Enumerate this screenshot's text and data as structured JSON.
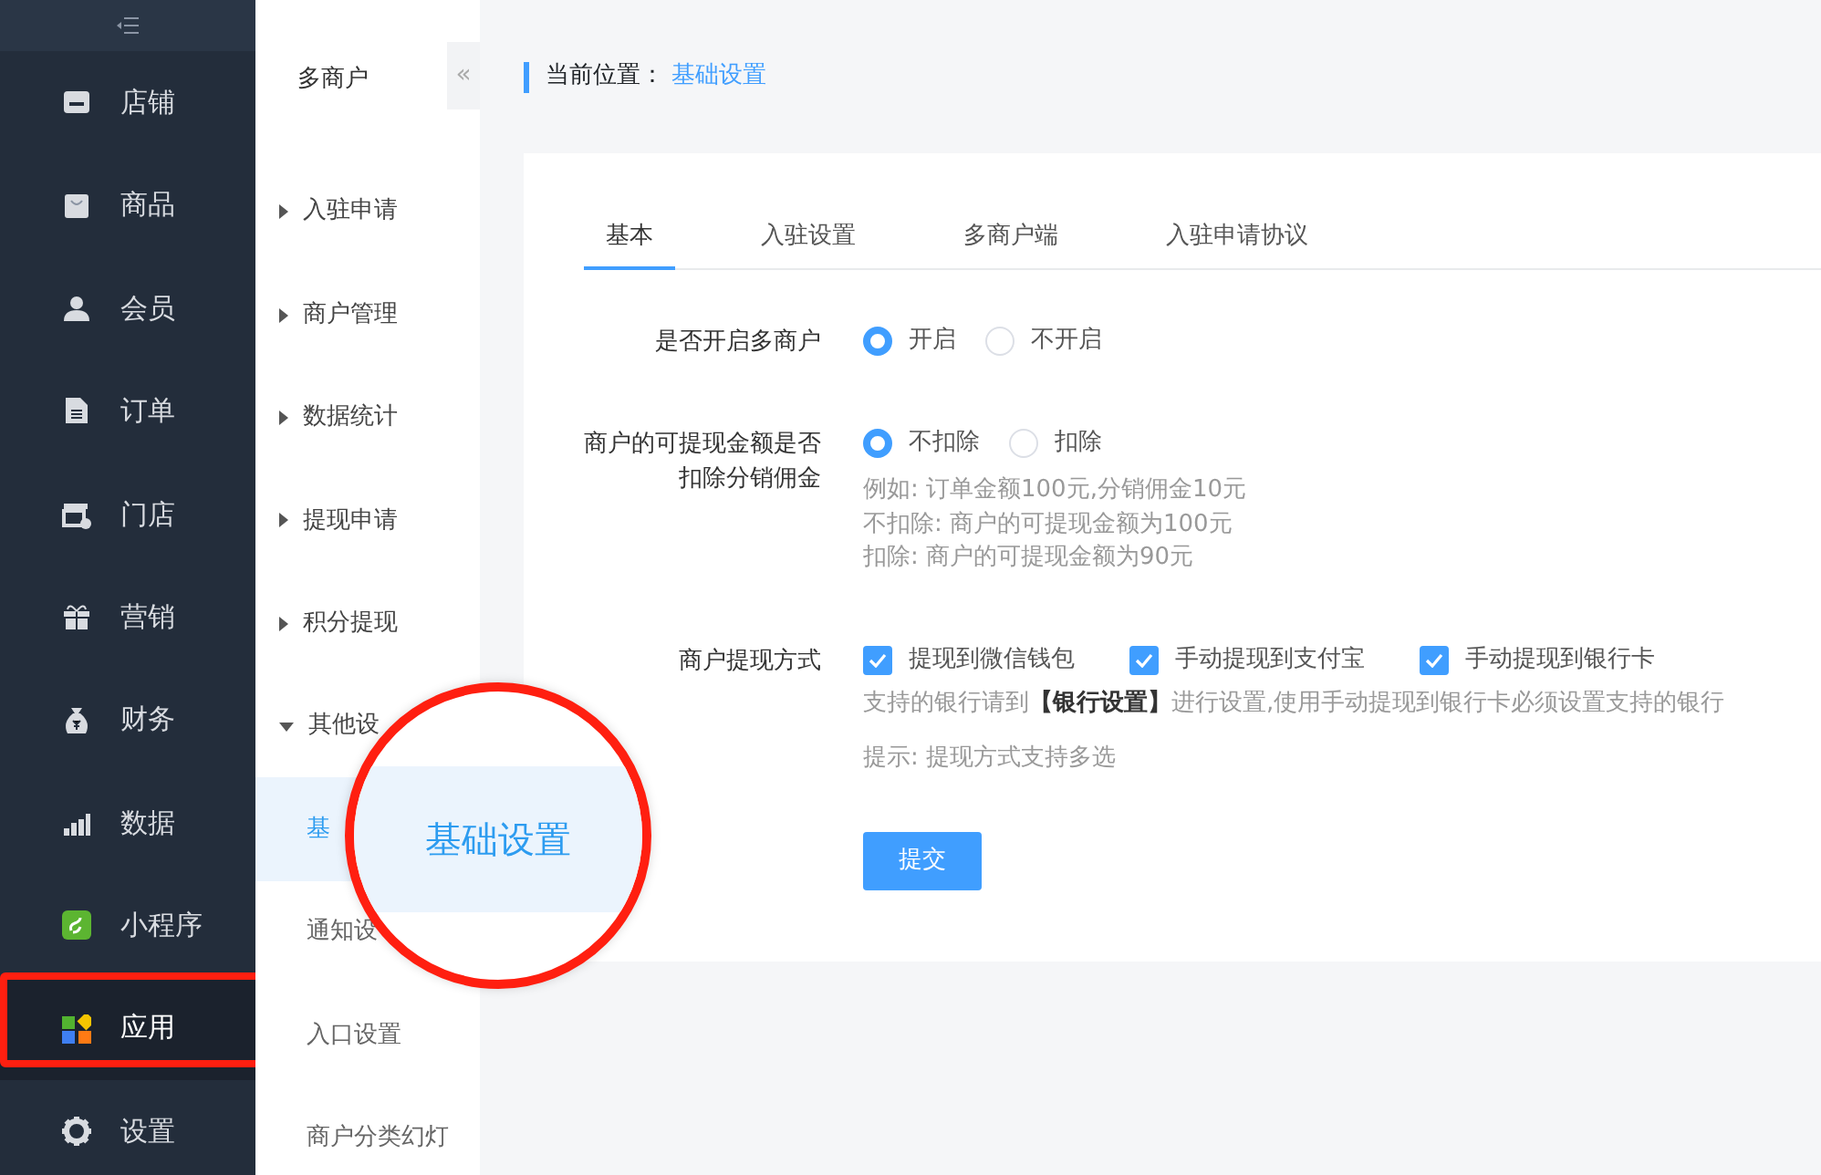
{
  "sidebar": {
    "items": [
      {
        "label": "店铺",
        "kind": "store",
        "selected": false,
        "highlighted": false
      },
      {
        "label": "商品",
        "kind": "bag",
        "selected": false,
        "highlighted": false
      },
      {
        "label": "会员",
        "kind": "user",
        "selected": false,
        "highlighted": false
      },
      {
        "label": "订单",
        "kind": "doc",
        "selected": false,
        "highlighted": false
      },
      {
        "label": "门店",
        "kind": "shop",
        "selected": false,
        "highlighted": false
      },
      {
        "label": "营销",
        "kind": "gift",
        "selected": false,
        "highlighted": false
      },
      {
        "label": "财务",
        "kind": "money",
        "selected": false,
        "highlighted": false
      },
      {
        "label": "数据",
        "kind": "chart",
        "selected": false,
        "highlighted": false
      },
      {
        "label": "小程序",
        "kind": "mini",
        "selected": false,
        "highlighted": false
      },
      {
        "label": "应用",
        "kind": "apps",
        "selected": true,
        "highlighted": true
      },
      {
        "label": "设置",
        "kind": "gear",
        "selected": false,
        "highlighted": false
      }
    ]
  },
  "subnav": {
    "title": "多商户",
    "collapse_button": "«",
    "items": [
      {
        "label": "入驻申请",
        "expanded": false
      },
      {
        "label": "商户管理",
        "expanded": false
      },
      {
        "label": "数据统计",
        "expanded": false
      },
      {
        "label": "提现申请",
        "expanded": false
      },
      {
        "label": "积分提现",
        "expanded": false
      },
      {
        "label": "其他设",
        "expanded": true,
        "children": [
          {
            "label": "基",
            "selected": true
          },
          {
            "label": "通知设",
            "selected": false
          },
          {
            "label": "入口设置",
            "selected": false
          },
          {
            "label": "商户分类幻灯",
            "selected": false
          }
        ]
      }
    ]
  },
  "breadcrumb": {
    "label": "当前位置：",
    "current": "基础设置"
  },
  "tabs": [
    {
      "label": "基本",
      "selected": true
    },
    {
      "label": "入驻设置",
      "selected": false
    },
    {
      "label": "多商户端",
      "selected": false
    },
    {
      "label": "入驻申请协议",
      "selected": false
    }
  ],
  "form": [
    {
      "label": "是否开启多商户",
      "kind": "radio",
      "options": [
        {
          "label": "开启",
          "selected": true
        },
        {
          "label": "不开启",
          "selected": false
        }
      ]
    },
    {
      "label": "商户的可提现金额是否扣除分销佣金",
      "kind": "radio",
      "options": [
        {
          "label": "不扣除",
          "selected": true
        },
        {
          "label": "扣除",
          "selected": false
        }
      ],
      "help": [
        "例如: 订单金额100元,分销佣金10元",
        "不扣除: 商户的可提现金额为100元",
        "扣除: 商户的可提现金额为90元"
      ]
    },
    {
      "label": "商户提现方式",
      "kind": "checkbox",
      "options": [
        {
          "label": "提现到微信钱包",
          "checked": true
        },
        {
          "label": "手动提现到支付宝",
          "checked": true
        },
        {
          "label": "手动提现到银行卡",
          "checked": true
        }
      ],
      "help": [
        "支持的银行请到**【银行设置】**进行设置,使用手动提现到银行卡必须设置支持的银行"
      ],
      "hint": "提示: 提现方式支持多选"
    }
  ],
  "submit_button": "提交",
  "magnifier": {
    "text": "基础设置"
  }
}
